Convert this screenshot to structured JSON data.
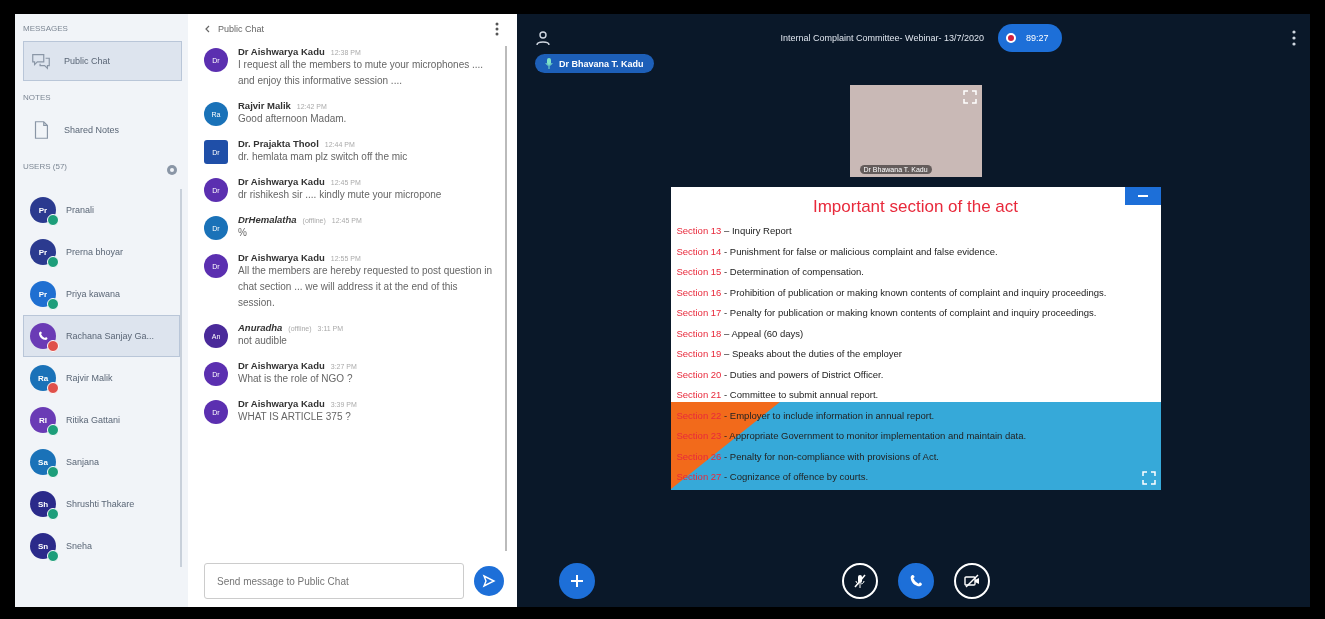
{
  "sidebar": {
    "messages_heading": "MESSAGES",
    "public_chat": {
      "label": "Public Chat",
      "selected": true
    },
    "notes_heading": "NOTES",
    "shared_notes": {
      "label": "Shared Notes",
      "selected": false
    },
    "users_heading": "USERS (57)",
    "users": [
      {
        "name": "Pranali",
        "kind": "initials",
        "initials": "Pr",
        "color": "#2b3a8f",
        "muted": false,
        "selected": false
      },
      {
        "name": "Prerna bhoyar",
        "kind": "initials",
        "initials": "Pr",
        "color": "#2b3a8f",
        "muted": false,
        "selected": false
      },
      {
        "name": "Priya kawana",
        "kind": "initials",
        "initials": "Pr",
        "color": "#1f6fd1",
        "muted": false,
        "selected": false
      },
      {
        "name": "Rachana Sanjay Ga...",
        "kind": "phone",
        "color": "#6a3bb5",
        "muted": true,
        "selected": true
      },
      {
        "name": "Rajvir Malik",
        "kind": "initials",
        "initials": "Ra",
        "color": "#1a72b8",
        "muted": true,
        "selected": false
      },
      {
        "name": "Ritika Gattani",
        "kind": "initials",
        "initials": "RI",
        "color": "#6a3bb5",
        "muted": false,
        "selected": false
      },
      {
        "name": "Sanjana",
        "kind": "initials",
        "initials": "Sa",
        "color": "#1a72b8",
        "muted": false,
        "selected": false
      },
      {
        "name": "Shrushti Thakare",
        "kind": "initials",
        "initials": "Sh",
        "color": "#2b2a8a",
        "muted": false,
        "selected": false
      },
      {
        "name": "Sneha",
        "kind": "initials",
        "initials": "Sn",
        "color": "#2b2a8a",
        "muted": false,
        "selected": false
      }
    ]
  },
  "chat": {
    "title": "Public Chat",
    "placeholder": "Send message to Public Chat",
    "messages": [
      {
        "initials": "Dr",
        "color": "#5b2fb0",
        "square": false,
        "name": "Dr Aishwarya Kadu",
        "offline": false,
        "time": "12:38 PM",
        "text": "I request all the members to mute your microphones .... and enjoy this informative session ...."
      },
      {
        "initials": "Ra",
        "color": "#1a72b8",
        "square": false,
        "name": "Rajvir Malik",
        "offline": false,
        "time": "12:42 PM",
        "text": "Good afternoon Madam."
      },
      {
        "initials": "Dr",
        "color": "#1f4fa8",
        "square": true,
        "name": "Dr. Prajakta Thool",
        "offline": false,
        "time": "12:44 PM",
        "text": "dr. hemlata mam plz switch off the mic"
      },
      {
        "initials": "Dr",
        "color": "#5b2fb0",
        "square": false,
        "name": "Dr Aishwarya Kadu",
        "offline": false,
        "time": "12:45 PM",
        "text": "dr rishikesh sir .... kindly mute your micropone"
      },
      {
        "initials": "Dr",
        "color": "#1a72b8",
        "square": false,
        "name": "DrHemalatha",
        "offline": true,
        "offline_label": "(offline)",
        "time": "12:45 PM",
        "text": "%"
      },
      {
        "initials": "Dr",
        "color": "#5b2fb0",
        "square": false,
        "name": "Dr Aishwarya Kadu",
        "offline": false,
        "time": "12:55 PM",
        "text": "All the members are hereby requested to post question in chat section ... we will address it at the end of this session."
      },
      {
        "initials": "An",
        "color": "#4a2a9a",
        "square": false,
        "name": "Anuradha",
        "offline": true,
        "offline_label": "(offline)",
        "time": "3:11 PM",
        "text": "not audible"
      },
      {
        "initials": "Dr",
        "color": "#5b2fb0",
        "square": false,
        "name": "Dr Aishwarya Kadu",
        "offline": false,
        "time": "3:27 PM",
        "text": "What is the role of NGO ?"
      },
      {
        "initials": "Dr",
        "color": "#5b2fb0",
        "square": false,
        "name": "Dr Aishwarya Kadu",
        "offline": false,
        "time": "3:39 PM",
        "text": "WHAT IS ARTICLE 375 ?"
      }
    ]
  },
  "meeting": {
    "title": "Internal Complaint Committee- Webinar- 13/7/2020",
    "recording_time": "89:27",
    "recording": true,
    "presenter": "Dr Bhavana T. Kadu",
    "video_name": "Dr Bhawana T. Kadu",
    "slide": {
      "title": "Important section of the act",
      "sections": [
        {
          "number": "Section 13",
          "text": "– Inquiry Report"
        },
        {
          "number": "Section 14",
          "text": "- Punishment for false or malicious complaint and false evidence."
        },
        {
          "number": "Section 15",
          "text": "- Determination of compensation."
        },
        {
          "number": "Section 16",
          "text": "- Prohibition of publication or making known contents of complaint and inquiry proceedings."
        },
        {
          "number": "Section 17",
          "text": "- Penalty for publication or making known contents of complaint and inquiry proceedings."
        },
        {
          "number": "Section 18",
          "text": "– Appeal (60 days)"
        },
        {
          "number": "Section 19",
          "text": "– Speaks about the duties of the employer"
        },
        {
          "number": "Section 20",
          "text": "- Duties and powers of District Officer."
        },
        {
          "number": "Section 21",
          "text": "- Committee to submit annual report."
        },
        {
          "number": "Section 22",
          "text": "- Employer to include information in annual report."
        },
        {
          "number": "Section 23",
          "text": "- Appropriate Government to monitor implementation and maintain data."
        },
        {
          "number": "Section 26",
          "text": "- Penalty for non-compliance with provisions of Act."
        },
        {
          "number": "Section 27",
          "text": "- Cognizance of offence by courts."
        }
      ]
    },
    "controls": {
      "muted": true,
      "video_off": true
    }
  }
}
